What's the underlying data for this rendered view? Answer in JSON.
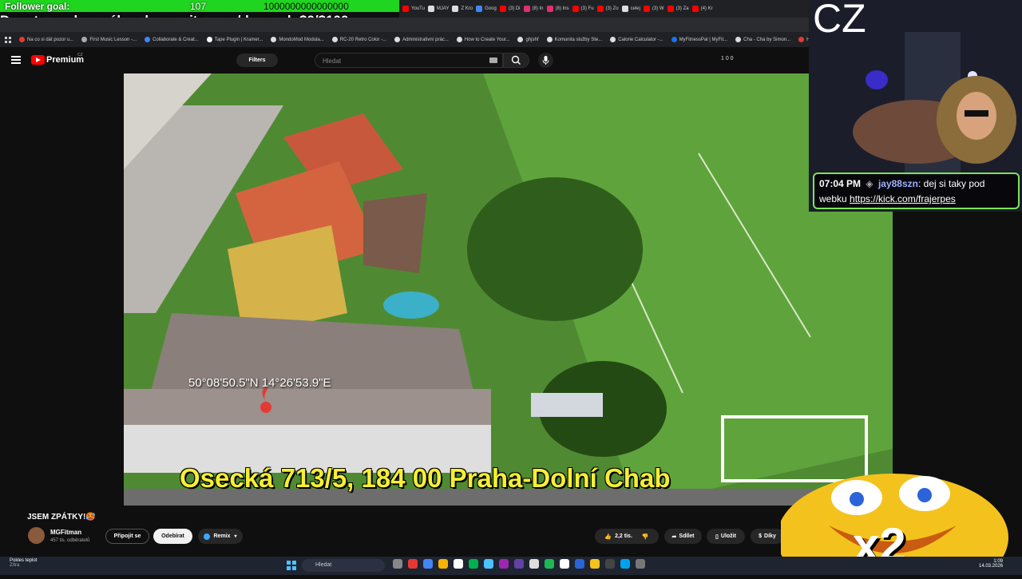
{
  "follower_goal": {
    "label": "Follower goal:",
    "current": "107",
    "target": "1000000000000000"
  },
  "donate_text": "Donate goal na nákup komunita.com/deynyel: $0/$100",
  "browser_tabs": [
    {
      "label": "YouTu",
      "color": "#ff0000"
    },
    {
      "label": "MJAY",
      "color": "#dddddd"
    },
    {
      "label": "Z Kro",
      "color": "#dddddd"
    },
    {
      "label": "Goog",
      "color": "#4285f4"
    },
    {
      "label": "(3) Di",
      "color": "#ff0000"
    },
    {
      "label": "(8) In",
      "color": "#e1306c"
    },
    {
      "label": "(8) Ins",
      "color": "#e1306c"
    },
    {
      "label": "(3) Fu",
      "color": "#ff0000"
    },
    {
      "label": "(3) Zo",
      "color": "#ff0000"
    },
    {
      "label": "celej",
      "color": "#dddddd"
    },
    {
      "label": "(3) W",
      "color": "#ff0000"
    },
    {
      "label": "(3) Za",
      "color": "#ff0000"
    },
    {
      "label": "(4) Kr",
      "color": "#ff0000"
    }
  ],
  "bookmarks": [
    {
      "label": "Na co si dát pozor u...",
      "color": "#e53935"
    },
    {
      "label": "First Music Lesson -...",
      "color": "#aaaaaa"
    },
    {
      "label": "Collaborate & Creat...",
      "color": "#4285f4"
    },
    {
      "label": "Tape Plugin | Kramer...",
      "color": "#ffffff"
    },
    {
      "label": "MondoMod Modula...",
      "color": "#dddddd"
    },
    {
      "label": "RC-20 Retro Color -...",
      "color": "#dddddd"
    },
    {
      "label": "Administrativní prác...",
      "color": "#dddddd"
    },
    {
      "label": "How to Create Your...",
      "color": "#dddddd"
    },
    {
      "label": "ghjshf",
      "color": "#dddddd"
    },
    {
      "label": "Komunita služby Ste...",
      "color": "#dddddd"
    },
    {
      "label": "Calorie Calculator -...",
      "color": "#dddddd"
    },
    {
      "label": "MyFitnessPal | MyFit...",
      "color": "#1a73e8"
    },
    {
      "label": "Cha - Cha by Simon...",
      "color": "#dddddd"
    },
    {
      "label": "Hype",
      "color": "#e53935"
    }
  ],
  "youtube": {
    "logo_text": "Premium",
    "region": "CZ",
    "filters_label": "Filters",
    "search_placeholder": "Hledat",
    "header_counts": "1  0  0"
  },
  "video": {
    "coordinates": "50°08'50.5\"N 14°26'53.9\"E",
    "address": "Osecká 713/5, 184 00 Praha-Dolní Chab"
  },
  "below_video": {
    "title": "JSEM ZPÁTKY!🥵",
    "channel": "MGFitman",
    "subscribers": "457 tis. odběratelů",
    "join": "Připojit se",
    "subscribe": "Odebírat",
    "remix": "Remix",
    "likes": "2,2 tis.",
    "share": "Sdílet",
    "save": "Uložit",
    "thanks": "Díky"
  },
  "webcam": {
    "cz_label": "CZ",
    "chat": {
      "time": "07:04 PM",
      "user": "jay88szn",
      "message_pre": "dej si taky pod webku ",
      "link": "https://kick.com/frajerpes"
    }
  },
  "taskbar": {
    "weather_title": "Pokles teplot",
    "weather_sub": "Zítra",
    "search_placeholder": "Hledat",
    "time": "1:09",
    "date": "14.03.2026"
  },
  "emoji_overlay": {
    "label": "x2"
  }
}
